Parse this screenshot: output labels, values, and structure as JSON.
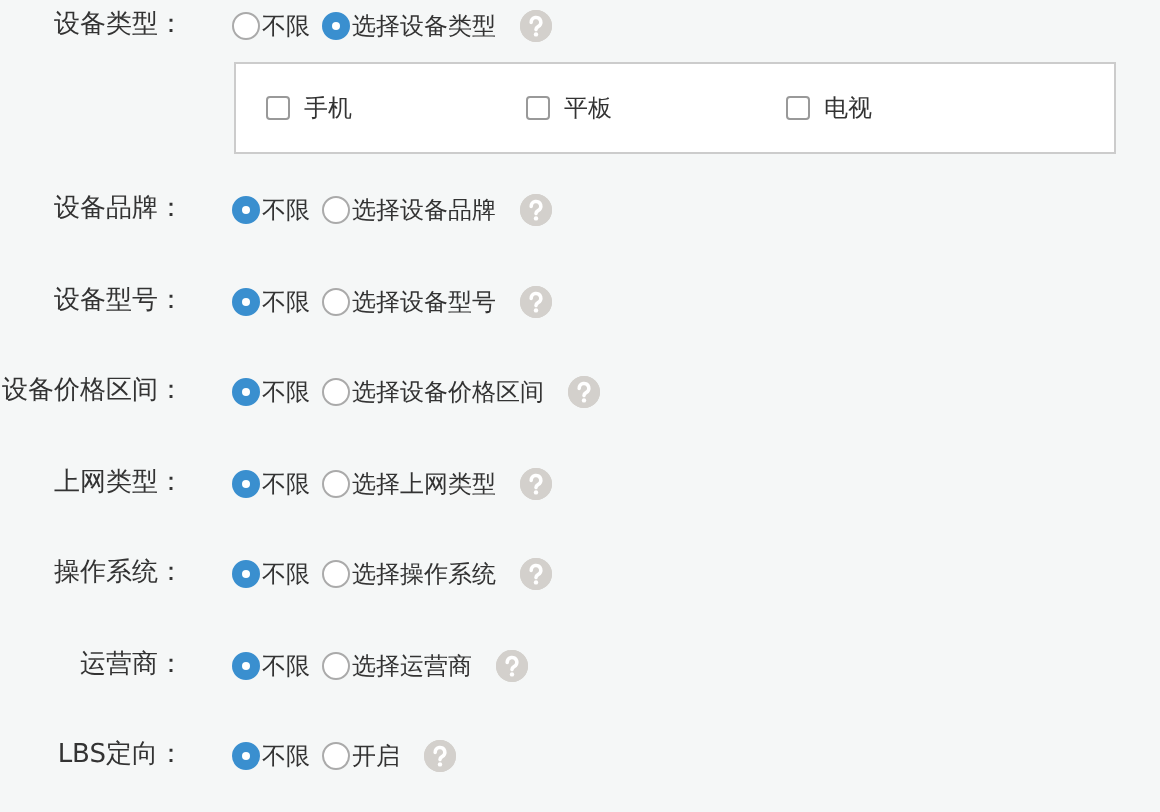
{
  "rows": [
    {
      "label": "设备类型：",
      "options": [
        {
          "label": "不限",
          "selected": false
        },
        {
          "label": "选择设备类型",
          "selected": true
        }
      ],
      "checkboxes": [
        {
          "label": "手机",
          "checked": false
        },
        {
          "label": "平板",
          "checked": false
        },
        {
          "label": "电视",
          "checked": false
        }
      ]
    },
    {
      "label": "设备品牌：",
      "options": [
        {
          "label": "不限",
          "selected": true
        },
        {
          "label": "选择设备品牌",
          "selected": false
        }
      ]
    },
    {
      "label": "设备型号：",
      "options": [
        {
          "label": "不限",
          "selected": true
        },
        {
          "label": "选择设备型号",
          "selected": false
        }
      ]
    },
    {
      "label": "设备价格区间：",
      "options": [
        {
          "label": "不限",
          "selected": true
        },
        {
          "label": "选择设备价格区间",
          "selected": false
        }
      ]
    },
    {
      "label": "上网类型：",
      "options": [
        {
          "label": "不限",
          "selected": true
        },
        {
          "label": "选择上网类型",
          "selected": false
        }
      ]
    },
    {
      "label": "操作系统：",
      "options": [
        {
          "label": "不限",
          "selected": true
        },
        {
          "label": "选择操作系统",
          "selected": false
        }
      ]
    },
    {
      "label": "运营商：",
      "options": [
        {
          "label": "不限",
          "selected": true
        },
        {
          "label": "选择运营商",
          "selected": false
        }
      ]
    },
    {
      "label": "LBS定向：",
      "options": [
        {
          "label": "不限",
          "selected": true
        },
        {
          "label": "开启",
          "selected": false
        }
      ]
    }
  ]
}
